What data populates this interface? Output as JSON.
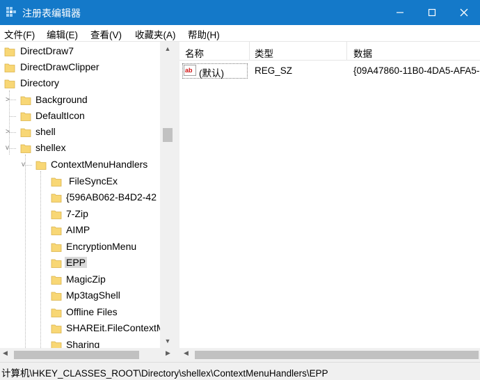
{
  "window": {
    "title": "注册表编辑器",
    "accent": "#1479c9"
  },
  "menu": [
    "文件(F)",
    "编辑(E)",
    "查看(V)",
    "收藏夹(A)",
    "帮助(H)"
  ],
  "tree": [
    {
      "label": "DirectDraw7",
      "expander": ""
    },
    {
      "label": "DirectDrawClipper",
      "expander": ""
    },
    {
      "label": "Directory",
      "expander": ""
    },
    {
      "label": "Background",
      "expander": ">"
    },
    {
      "label": "DefaultIcon",
      "expander": ""
    },
    {
      "label": "shell",
      "expander": ">"
    },
    {
      "label": "shellex",
      "expander": "v"
    },
    {
      "label": "ContextMenuHandlers",
      "expander": "v"
    },
    {
      "label": "FileSyncEx",
      "expander": ""
    },
    {
      "label": "{596AB062-B4D2-42",
      "expander": ""
    },
    {
      "label": "7-Zip",
      "expander": ""
    },
    {
      "label": "AIMP",
      "expander": ""
    },
    {
      "label": "EncryptionMenu",
      "expander": ""
    },
    {
      "label": "EPP",
      "expander": "",
      "selected": true
    },
    {
      "label": "MagicZip",
      "expander": ""
    },
    {
      "label": "Mp3tagShell",
      "expander": ""
    },
    {
      "label": "Offline Files",
      "expander": ""
    },
    {
      "label": "SHAREit.FileContextM",
      "expander": ""
    },
    {
      "label": "Sharing",
      "expander": ""
    }
  ],
  "list": {
    "columns": [
      "名称",
      "类型",
      "数据"
    ],
    "rows": [
      {
        "icon": "ab",
        "name": "(默认)",
        "type": "REG_SZ",
        "data": "{09A47860-11B0-4DA5-AFA5-"
      }
    ]
  },
  "status": "计算机\\HKEY_CLASSES_ROOT\\Directory\\shellex\\ContextMenuHandlers\\EPP",
  "colors": {
    "folder": "#f8d775",
    "folder_edge": "#d9b24a",
    "selection": "#d9d9d9"
  }
}
